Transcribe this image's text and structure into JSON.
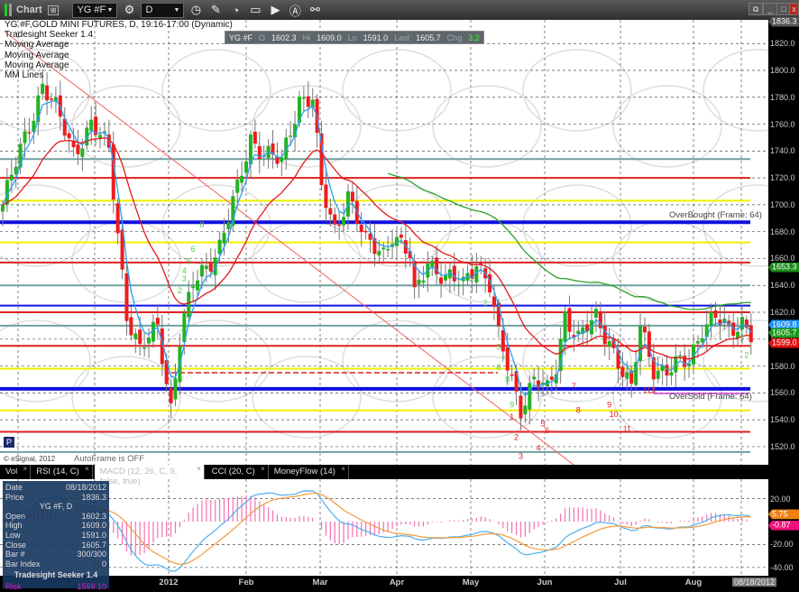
{
  "window": {
    "title": "Chart",
    "symbol": "YG #F",
    "interval": "D"
  },
  "legend": {
    "title": "YG #F,GOLD MINI FUTURES, D, 19:16-17:00 (Dynamic)",
    "studies": [
      "Tradesight Seeker 1.4",
      "Moving Average",
      "Moving Average",
      "Moving Average",
      "MM Lines"
    ]
  },
  "quote": {
    "symbol": "YG #F",
    "o_label": "O",
    "o": "1602.3",
    "hi_label": "Hi",
    "hi": "1609.0",
    "lo_label": "Lo",
    "lo": "1591.0",
    "last_label": "Last",
    "last": "1605.7",
    "chg_label": "Chg",
    "chg": "3.2"
  },
  "price_axis": {
    "labels": [
      "1820.0",
      "1800.0",
      "1780.0",
      "1760.0",
      "1740.0",
      "1720.0",
      "1700.0",
      "1680.0",
      "1660.0",
      "1640.0",
      "1620.0",
      "1600.0",
      "1580.0",
      "1560.0",
      "1540.0",
      "1520.0"
    ],
    "tags": [
      {
        "text": "1836.3",
        "price": 1836.3,
        "color": "#555555"
      },
      {
        "text": "1653.3",
        "price": 1653.3,
        "color": "#1a8a1a"
      },
      {
        "text": "1609.8",
        "price": 1610.6,
        "color": "#1e90ff"
      },
      {
        "text": "1605.7",
        "price": 1604.8,
        "color": "#1a9a1a"
      },
      {
        "text": "1599.0",
        "price": 1597.0,
        "color": "#e01010"
      }
    ]
  },
  "notes": {
    "copyright": "© eSignal, 2012",
    "autoframe": "AutoFrame is OFF",
    "overbought": "OverBought (Frame: 64)",
    "oversold": "OverSold (Frame: 64)",
    "p_button": "P"
  },
  "tabs": [
    {
      "label": "Vol"
    },
    {
      "label": "RSI (14, C)"
    },
    {
      "label": "MACD (12, 26, C, 9, false, true)"
    },
    {
      "label": "CCI (20, C)"
    },
    {
      "label": "MoneyFlow (14)"
    }
  ],
  "macd_axis": {
    "labels": [
      "20.00",
      "-20.00",
      "-40.00"
    ],
    "tag_signal": "5.75",
    "tag_hist": "-0.87"
  },
  "info_panel": {
    "date_label": "Date",
    "date": "08/18/2012",
    "price_label": "Price",
    "price": "1836.3",
    "title": "YG #F, D",
    "open_label": "Open",
    "open": "1602.3",
    "high_label": "High",
    "high": "1609.0",
    "low_label": "Low",
    "low": "1591.0",
    "close_label": "Close",
    "close": "1605.7",
    "bar_label": "Bar #",
    "bar": "300/300",
    "barindex_label": "Bar Index",
    "barindex": "0",
    "study": "Tradesight Seeker 1.4",
    "risk_label": "Risk",
    "risk": "1559.10"
  },
  "date_axis": {
    "labels": [
      "2012",
      "Feb",
      "Mar",
      "Apr",
      "May",
      "Jun",
      "Jul",
      "Aug"
    ],
    "current": "08/18/2012"
  },
  "colors": {
    "up": "#22b322",
    "down": "#ee1c1c",
    "fast_ma": "#2a9df4",
    "mid_ma": "#e41a1a",
    "slow_ma": "#2aa02a",
    "macd": "#4db0f0",
    "signal": "#f39a3c",
    "hist": "#f050a0"
  },
  "chart_data": {
    "type": "candlestick",
    "bars": 170,
    "close_anchors": [
      [
        0,
        1700
      ],
      [
        4,
        1740
      ],
      [
        9,
        1790
      ],
      [
        12,
        1770
      ],
      [
        16,
        1740
      ],
      [
        20,
        1760
      ],
      [
        24,
        1740
      ],
      [
        28,
        1620
      ],
      [
        31,
        1590
      ],
      [
        35,
        1610
      ],
      [
        38,
        1550
      ],
      [
        40,
        1600
      ],
      [
        43,
        1640
      ],
      [
        49,
        1670
      ],
      [
        53,
        1710
      ],
      [
        56,
        1750
      ],
      [
        59,
        1740
      ],
      [
        63,
        1730
      ],
      [
        67,
        1780
      ],
      [
        70,
        1780
      ],
      [
        72,
        1710
      ],
      [
        75,
        1680
      ],
      [
        78,
        1710
      ],
      [
        82,
        1670
      ],
      [
        86,
        1665
      ],
      [
        88,
        1680
      ],
      [
        92,
        1660
      ],
      [
        93,
        1630
      ],
      [
        96,
        1660
      ],
      [
        100,
        1645
      ],
      [
        104,
        1640
      ],
      [
        107,
        1660
      ],
      [
        110,
        1640
      ],
      [
        112,
        1600
      ],
      [
        115,
        1570
      ],
      [
        117,
        1550
      ],
      [
        120,
        1570
      ],
      [
        123,
        1560
      ],
      [
        125,
        1580
      ],
      [
        127,
        1620
      ],
      [
        130,
        1600
      ],
      [
        134,
        1615
      ],
      [
        137,
        1600
      ],
      [
        140,
        1575
      ],
      [
        142,
        1560
      ],
      [
        144,
        1610
      ],
      [
        147,
        1580
      ],
      [
        150,
        1575
      ],
      [
        155,
        1585
      ],
      [
        158,
        1610
      ],
      [
        161,
        1615
      ],
      [
        164,
        1605
      ],
      [
        167,
        1615
      ],
      [
        169,
        1605
      ]
    ],
    "levels": [
      {
        "price": 1734,
        "color": "#6fa0a0"
      },
      {
        "price": 1720,
        "color": "#e02020"
      },
      {
        "price": 1703,
        "color": "#f0f000"
      },
      {
        "price": 1687,
        "color": "#1010e0",
        "thick": true
      },
      {
        "price": 1672,
        "color": "#f0f000"
      },
      {
        "price": 1657,
        "color": "#e02020"
      },
      {
        "price": 1640,
        "color": "#6fa0a0"
      },
      {
        "price": 1625,
        "color": "#1010e0"
      },
      {
        "price": 1620,
        "color": "#e02020"
      },
      {
        "price": 1610,
        "color": "#6fa0a0"
      },
      {
        "price": 1595,
        "color": "#e02020"
      },
      {
        "price": 1578,
        "color": "#f0f000"
      },
      {
        "price": 1563,
        "color": "#1010e0",
        "thick": true
      },
      {
        "price": 1547,
        "color": "#f0f000"
      },
      {
        "price": 1531,
        "color": "#e02020"
      },
      {
        "price": 1516,
        "color": "#6fa0a0"
      }
    ],
    "annotations": [
      {
        "t": "1",
        "bar": 115,
        "price": 1540,
        "c": "#e02020"
      },
      {
        "t": "2",
        "bar": 116,
        "price": 1525,
        "c": "#e02020"
      },
      {
        "t": "3",
        "bar": 117,
        "price": 1511,
        "c": "#e02020"
      },
      {
        "t": "4",
        "bar": 121,
        "price": 1517,
        "c": "#e02020"
      },
      {
        "t": "5",
        "bar": 122,
        "price": 1535,
        "c": "#e02020"
      },
      {
        "t": "6",
        "bar": 123,
        "price": 1530,
        "c": "#e02020"
      },
      {
        "t": "7",
        "bar": 129,
        "price": 1563,
        "c": "#e02020"
      },
      {
        "t": "8",
        "bar": 130,
        "price": 1545,
        "c": "#e02020"
      },
      {
        "t": "9",
        "bar": 137,
        "price": 1549,
        "c": "#e02020"
      },
      {
        "t": "10",
        "bar": 138,
        "price": 1542,
        "c": "#e02020"
      },
      {
        "t": "11",
        "bar": 141,
        "price": 1531,
        "c": "#e02020"
      },
      {
        "t": "113",
        "bar": 146,
        "price": 1560,
        "c": "#e02020"
      },
      {
        "t": "2",
        "bar": 40,
        "price": 1634,
        "c": "#5c5"
      },
      {
        "t": "3",
        "bar": 41,
        "price": 1643,
        "c": "#5c5"
      },
      {
        "t": "4",
        "bar": 41,
        "price": 1649,
        "c": "#5c5"
      },
      {
        "t": "5",
        "bar": 42,
        "price": 1656,
        "c": "#5c5"
      },
      {
        "t": "6",
        "bar": 43,
        "price": 1665,
        "c": "#5c5"
      },
      {
        "t": "8",
        "bar": 45,
        "price": 1683,
        "c": "#5c5"
      },
      {
        "t": "2",
        "bar": 109,
        "price": 1625,
        "c": "#5c5"
      },
      {
        "t": "5",
        "bar": 112,
        "price": 1592,
        "c": "#5c5"
      },
      {
        "t": "7",
        "bar": 113,
        "price": 1583,
        "c": "#5c5"
      },
      {
        "t": "6",
        "bar": 112,
        "price": 1577,
        "c": "#5c5"
      },
      {
        "t": "8",
        "bar": 114,
        "price": 1568,
        "c": "#5c5"
      },
      {
        "t": "9",
        "bar": 115,
        "price": 1549,
        "c": "#5c5"
      },
      {
        "t": "1",
        "bar": 167,
        "price": 1601,
        "c": "#5c5"
      },
      {
        "t": "2",
        "bar": 168,
        "price": 1586,
        "c": "#5c5"
      }
    ],
    "slow_ma_start_bar": 87,
    "macd": {
      "fast": 12,
      "slow": 26,
      "signal": 9,
      "ylim": [
        -45,
        30
      ]
    }
  }
}
